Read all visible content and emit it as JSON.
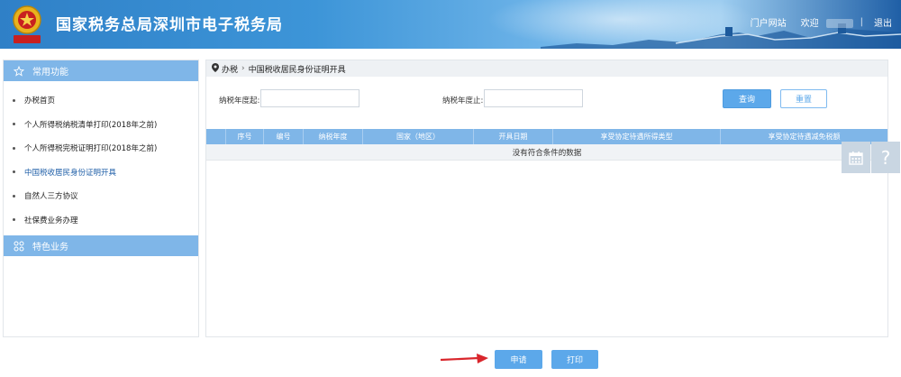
{
  "header": {
    "site_title": "国家税务总局深圳市电子税务局",
    "emblem_text": "中国税务",
    "portal_link": "门户网站",
    "welcome_label": "欢迎",
    "logout": "退出"
  },
  "sidebar": {
    "common_title": "常用功能",
    "items": [
      {
        "label": "办税首页"
      },
      {
        "label": "个人所得税纳税清单打印(2018年之前)"
      },
      {
        "label": "个人所得税完税证明打印(2018年之前)"
      },
      {
        "label": "中国税收居民身份证明开具"
      },
      {
        "label": "自然人三方协议"
      },
      {
        "label": "社保费业务办理"
      }
    ],
    "active_index": 3,
    "special_title": "特色业务"
  },
  "breadcrumb": {
    "root": "办税",
    "current": "中国税收居民身份证明开具"
  },
  "filters": {
    "year_from_label": "纳税年度起:",
    "year_from_value": "",
    "year_to_label": "纳税年度止:",
    "year_to_value": "",
    "query_button": "查询",
    "reset_button": "重置"
  },
  "table": {
    "columns": [
      "序号",
      "编号",
      "纳税年度",
      "国家（地区）",
      "开具日期",
      "享受协定待遇所得类型",
      "享受协定待遇减免税额"
    ],
    "empty_text": "没有符合条件的数据"
  },
  "actions": {
    "apply_button": "申请",
    "print_button": "打印"
  },
  "floating": {
    "calendar_icon": "calendar-icon",
    "help_icon": "help-icon",
    "help_glyph": "?"
  },
  "colors": {
    "accent": "#5ca8ea",
    "table_header": "#7fb6e8",
    "arrow": "#d9262c"
  }
}
